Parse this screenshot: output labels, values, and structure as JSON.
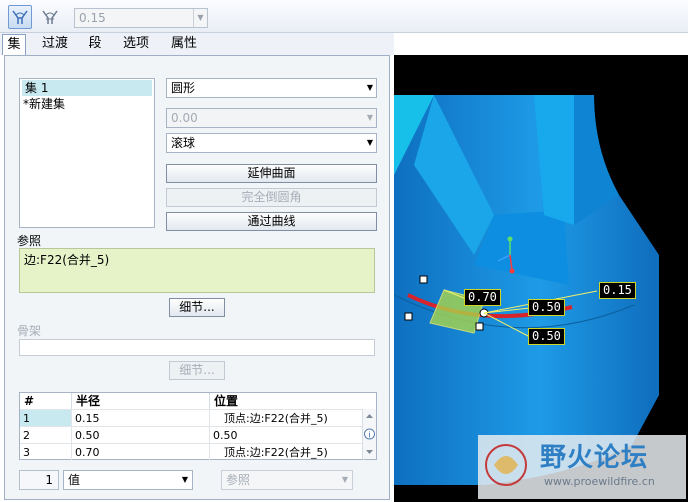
{
  "toolbar": {
    "icon1": "round-set-icon",
    "icon2": "round-variable-icon",
    "value": "0.15"
  },
  "tabs": [
    "集",
    "过渡",
    "段",
    "选项",
    "属性"
  ],
  "sets": {
    "items": [
      "集 1",
      "*新建集"
    ]
  },
  "shape_combo": "圆形",
  "value_combo": "0.00",
  "method_combo": "滚球",
  "buttons": {
    "extend": "延伸曲面",
    "full_round": "完全倒圆角",
    "through_curve": "通过曲线"
  },
  "reference": {
    "label": "参照",
    "value": "边:F22(合并_5)",
    "details": "细节..."
  },
  "skeleton": {
    "label": "骨架",
    "details": "细节..."
  },
  "radius_table": {
    "headers": [
      "#",
      "半径",
      "位置"
    ],
    "rows": [
      [
        "1",
        "0.15",
        "顶点:边:F22(合并_5)"
      ],
      [
        "2",
        "0.50",
        "0.50"
      ],
      [
        "3",
        "0.70",
        "顶点:边:F22(合并_5)"
      ]
    ]
  },
  "footer": {
    "count": "1",
    "type": "值",
    "ref": "参照"
  },
  "viewport": {
    "dims": [
      "0.15",
      "0.70",
      "0.50",
      "0.50"
    ],
    "watermark_title": "野火论坛",
    "watermark_url": "www.proewildfire.cn"
  },
  "colors": {
    "model": "#1e9be6",
    "accent_red": "#d9232a",
    "dim_border": "#cfd52a"
  }
}
